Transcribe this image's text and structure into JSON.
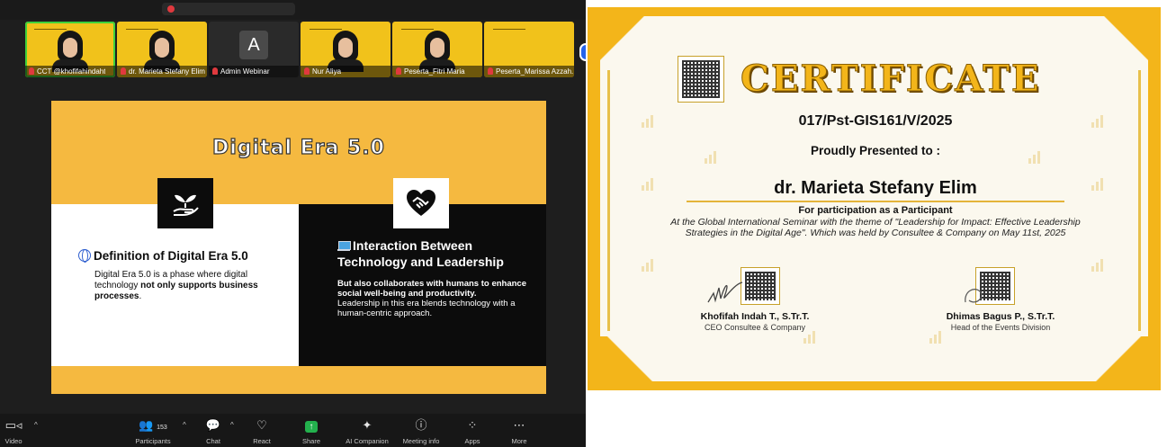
{
  "zoom": {
    "participants": [
      {
        "name": "CCT @khofifahindaht",
        "active": true
      },
      {
        "name": "dr. Marieta Stefany Elim",
        "active": false
      },
      {
        "name": "Admin Webinar",
        "letter": "A",
        "active": false
      },
      {
        "name": "Nur Aliya",
        "active": false
      },
      {
        "name": "Peserta_Fitri Maria",
        "active": false
      },
      {
        "name": "Peserta_Marissa Azzah...",
        "active": false
      }
    ],
    "slide": {
      "title": "Digital Era 5.0",
      "left_heading": "Definition of Digital Era 5.0",
      "left_text_1": "Digital Era 5.0 is a phase where digital technology ",
      "left_text_bold": "not only supports business processes",
      "left_text_2": ".",
      "right_heading": "Interaction Between Technology and Leadership",
      "right_bold": "But also collaborates with humans to enhance social well-being and productivity.",
      "right_text": "Leadership in this era blends technology with a human-centric approach."
    },
    "toolbar": {
      "video": "Video",
      "participants": "Participants",
      "participants_count": "153",
      "chat": "Chat",
      "react": "React",
      "share": "Share",
      "ai": "AI Companion",
      "info": "Meeting info",
      "apps": "Apps",
      "more": "More"
    },
    "colors": {
      "slide_gold": "#f5b940",
      "active_border": "#3fd13b",
      "share_green": "#23b14d"
    }
  },
  "certificate": {
    "title": "CERTIFICATE",
    "number": "017/Pst-GIS161/V/2025",
    "presented": "Proudly Presented to :",
    "recipient": "dr. Marieta Stefany Elim",
    "for": "For participation as a Participant",
    "description": "At the Global International Seminar with the theme of \"Leadership for Impact: Effective Leadership Strategies in the Digital Age\". Which was held by Consultee & Company on May 11st, 2025",
    "signer1_name": "Khofifah Indah T., S.Tr.T.",
    "signer1_role": "CEO Consultee & Company",
    "signer2_name": "Dhimas Bagus P., S.Tr.T.",
    "signer2_role": "Head of the Events Division",
    "colors": {
      "gold": "#f3b51a",
      "bg": "#fbf8ee"
    }
  }
}
